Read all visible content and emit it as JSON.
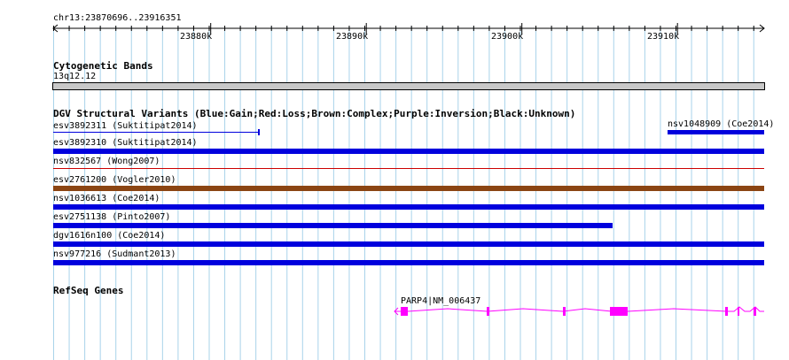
{
  "ruler": {
    "location": "chr13:23870696..23916351",
    "ticks": [
      "23880k",
      "23890k",
      "23900k",
      "23910k"
    ]
  },
  "cytoband": {
    "title": "Cytogenetic Bands",
    "band": "13q12.12"
  },
  "dgv": {
    "title": "DGV Structural Variants (Blue:Gain;Red:Loss;Brown:Complex;Purple:Inversion;Black:Unknown)",
    "colors": {
      "gain": "#0000dd",
      "loss": "#cc0000",
      "complex": "#8b4513"
    },
    "features": [
      {
        "label": "esv3892311 (Suktitipat2014)",
        "type": "gain",
        "style": "thin"
      },
      {
        "label": "nsv1048909 (Coe2014)",
        "type": "gain",
        "style": "thick"
      },
      {
        "label": "esv3892310 (Suktitipat2014)",
        "type": "gain",
        "style": "thick"
      },
      {
        "label": "nsv832567 (Wong2007)",
        "type": "loss",
        "style": "line"
      },
      {
        "label": "esv2761200 (Vogler2010)",
        "type": "complex",
        "style": "thick"
      },
      {
        "label": "nsv1036613 (Coe2014)",
        "type": "gain",
        "style": "thick"
      },
      {
        "label": "esv2751138 (Pinto2007)",
        "type": "gain",
        "style": "thick"
      },
      {
        "label": "dgv1616n100 (Coe2014)",
        "type": "gain",
        "style": "thick"
      },
      {
        "label": "nsv977216 (Sudmant2013)",
        "type": "gain",
        "style": "thick"
      }
    ]
  },
  "refseq": {
    "title": "RefSeq Genes",
    "gene_label": "PARP4|NM_006437",
    "color": "#ff00ff"
  }
}
